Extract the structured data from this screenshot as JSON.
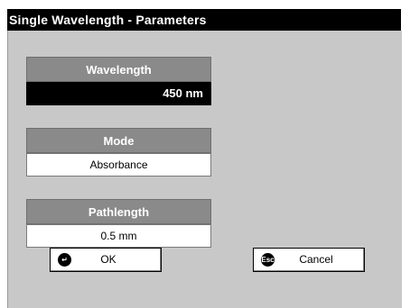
{
  "window": {
    "title": "Single Wavelength - Parameters"
  },
  "params": {
    "wavelength": {
      "label": "Wavelength",
      "value": "450 nm"
    },
    "mode": {
      "label": "Mode",
      "value": "Absorbance"
    },
    "pathlength": {
      "label": "Pathlength",
      "value": "0.5 mm"
    }
  },
  "buttons": {
    "ok": {
      "label": "OK",
      "icon": "enter-icon"
    },
    "cancel": {
      "label": "Cancel",
      "icon": "esc-icon",
      "icon_text": "Esc"
    }
  }
}
